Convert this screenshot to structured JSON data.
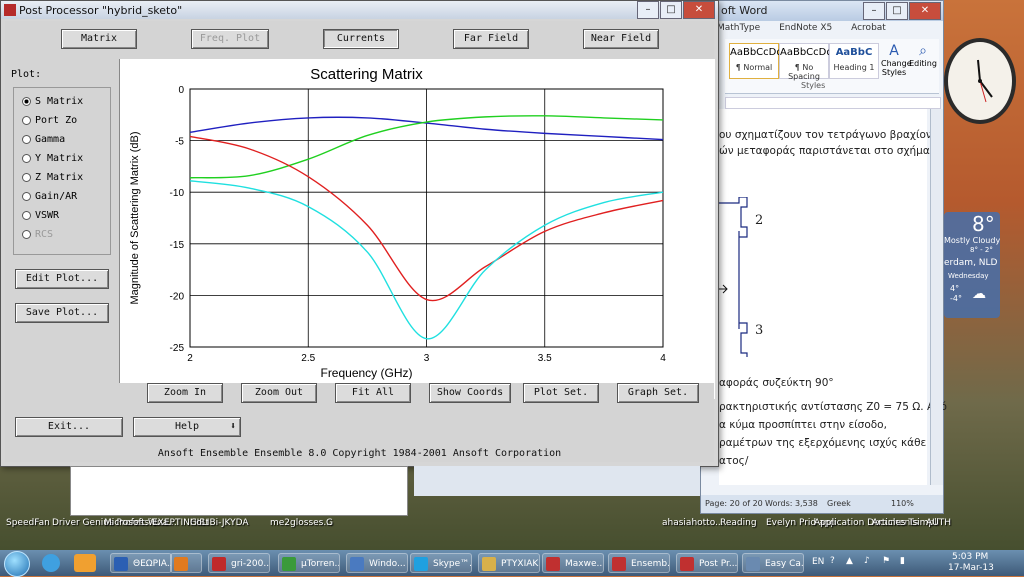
{
  "word": {
    "title": "oft Word",
    "ribbon_tabs": [
      "MathType",
      "EndNote X5",
      "Acrobat"
    ],
    "styles": [
      {
        "preview": "AaBbCcDd",
        "name": "¶ Normal"
      },
      {
        "preview": "AaBbCcDd",
        "name": "¶ No Spacing"
      },
      {
        "preview": "AaBbC",
        "name": "Heading 1"
      }
    ],
    "change_styles": "Change Styles",
    "editing": "Editing",
    "styles_group": "Styles",
    "doc_lines": [
      "ου σχηματίζουν τον τετράγωνο βραχίονα",
      "ών μεταφοράς παριστάνεται στο σχήμα",
      "αφοράς συζεύκτη 90°",
      "ρακτηριστικής αντίστασης Z0 = 75 Ω. Από",
      "α κύμα προσπίπτει στην είσοδο,",
      "ραμέτρων της εξερχόμενης ισχύς κάθε",
      "ατος/"
    ],
    "port_labels": [
      "2",
      "3"
    ],
    "status": {
      "page": "Page: 20 of 20",
      "words": "Words: 3,538",
      "lang": "Greek",
      "zoom": "110%"
    }
  },
  "weather": {
    "temp": "8°",
    "desc": "Mostly Cloudy",
    "range": "8° - 2°",
    "city": "erdam, NLD",
    "day": "Wednesday",
    "hi": "4°",
    "lo": "-4°"
  },
  "pp": {
    "title": "Post Processor \"hybrid_sketo\"",
    "top_buttons": [
      "Matrix",
      "Freq. Plot",
      "Currents",
      "Far Field",
      "Near Field"
    ],
    "plot_label": "Plot:",
    "plot_options": [
      "S Matrix",
      "Port Zo",
      "Gamma",
      "Y Matrix",
      "Z Matrix",
      "Gain/AR",
      "VSWR",
      "RCS"
    ],
    "selected_option": "S Matrix",
    "edit_plot": "Edit Plot...",
    "save_plot": "Save Plot...",
    "bottom_buttons": [
      "Zoom In",
      "Zoom Out",
      "Fit All",
      "Show Coords",
      "Plot Set.",
      "Graph Set."
    ],
    "exit": "Exit...",
    "help": "Help",
    "footer": "Ansoft Ensemble    Ensemble 8.0    Copyright 1984-2001 Ansoft Corporation"
  },
  "chart_data": {
    "type": "line",
    "title": "Scattering Matrix",
    "xlabel": "Frequency (GHz)",
    "ylabel": "Magnitude of Scattering Matrix (dB)",
    "xlim": [
      2,
      4
    ],
    "ylim": [
      -25,
      0
    ],
    "xticks": [
      "2",
      "2.5",
      "3",
      "3.5",
      "4"
    ],
    "yticks": [
      "0",
      "-5",
      "-10",
      "-15",
      "-20",
      "-25"
    ],
    "grid": true,
    "x": [
      2.0,
      2.25,
      2.5,
      2.75,
      3.0,
      3.25,
      3.5,
      3.75,
      4.0
    ],
    "series": [
      {
        "color": "#2020c0",
        "values": [
          -4.2,
          -3.3,
          -2.8,
          -2.8,
          -3.3,
          -3.9,
          -4.3,
          -4.6,
          -4.9
        ]
      },
      {
        "color": "#20d020",
        "values": [
          -8.6,
          -8.4,
          -6.8,
          -4.5,
          -3.2,
          -2.7,
          -2.6,
          -2.8,
          -3.0
        ]
      },
      {
        "color": "#e02020",
        "values": [
          -4.6,
          -5.8,
          -8.5,
          -13.2,
          -20.4,
          -17.2,
          -13.8,
          -12.0,
          -10.8
        ]
      },
      {
        "color": "#20e0e0",
        "values": [
          -8.9,
          -9.6,
          -11.4,
          -15.8,
          -24.2,
          -17.5,
          -13.2,
          -11.0,
          -10.0
        ]
      }
    ]
  },
  "desk_icons": [
    "SpeedFan",
    "Driver Genius Professiona...",
    "Microsoft.W...",
    "EXEPTINHIBt",
    "CoLIBi-JKYDA",
    "me2glosses...",
    "G",
    "ahasiahotto...",
    "Reading",
    "Evelyn Prid app",
    "Application Documents",
    "Articles Tsimpli",
    "AUTH"
  ],
  "taskbar": [
    {
      "label": "ΘΕΩΡΙΑ...",
      "color": "#2b5fb3"
    },
    {
      "label": "",
      "color": "#e07a1f"
    },
    {
      "label": "gri-200...",
      "color": "#c02a2a"
    },
    {
      "label": "µTorren...",
      "color": "#3a9a3a"
    },
    {
      "label": "Windo...",
      "color": "#4a7ac0"
    },
    {
      "label": "Skype™...",
      "color": "#1fa0e0"
    },
    {
      "label": "PTYXIAKI",
      "color": "#d8b04a"
    },
    {
      "label": "Maxwe...",
      "color": "#c03030"
    },
    {
      "label": "Ensemb...",
      "color": "#c03030"
    },
    {
      "label": "Post Pr...",
      "color": "#c03030"
    },
    {
      "label": "Easy Ca...",
      "color": "#6a8ab0"
    }
  ],
  "tray": {
    "lang": "EN",
    "time": "5:03 PM",
    "date": "17-Mar-13"
  }
}
